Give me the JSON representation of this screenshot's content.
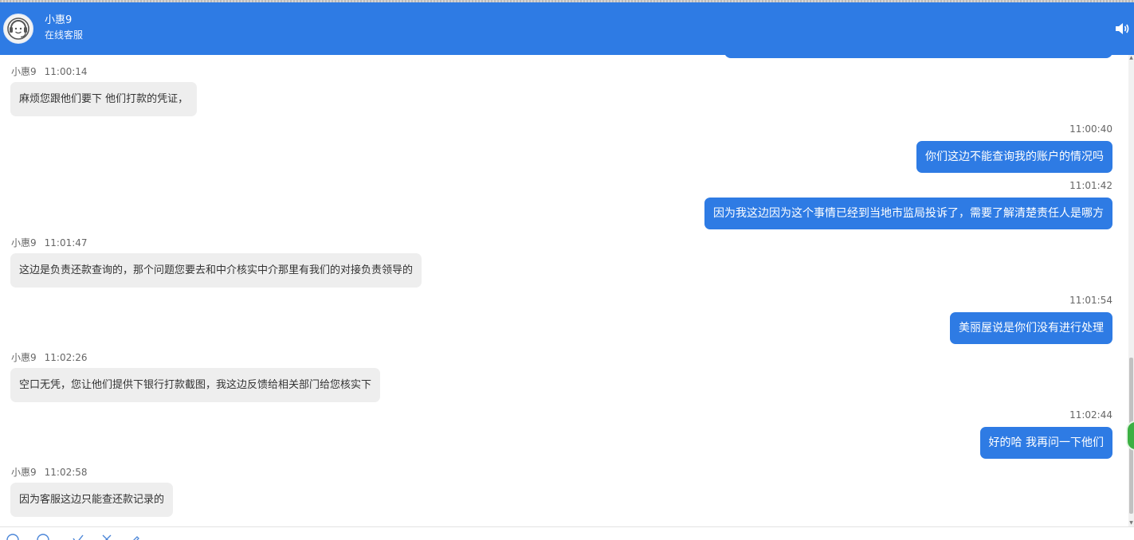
{
  "header": {
    "agent_name": "小惠9",
    "agent_status": "在线客服"
  },
  "messages": [
    {
      "side": "agent",
      "sender": "小惠9",
      "time": "11:00:14",
      "text": "麻烦您跟他们要下 他们打款的凭证，"
    },
    {
      "side": "user",
      "time": "11:00:40",
      "text": "你们这边不能查询我的账户的情况吗"
    },
    {
      "side": "user",
      "time": "11:01:42",
      "text": "因为我这边因为这个事情已经到当地市监局投诉了，需要了解清楚责任人是哪方"
    },
    {
      "side": "agent",
      "sender": "小惠9",
      "time": "11:01:47",
      "text": "这边是负责还款查询的，那个问题您要去和中介核实中介那里有我们的对接负责领导的"
    },
    {
      "side": "user",
      "time": "11:01:54",
      "text": "美丽屋说是你们没有进行处理"
    },
    {
      "side": "agent",
      "sender": "小惠9",
      "time": "11:02:26",
      "text": "空口无凭，您让他们提供下银行打款截图，我这边反馈给相关部门给您核实下"
    },
    {
      "side": "user",
      "time": "11:02:44",
      "text": "好的哈 我再问一下他们"
    },
    {
      "side": "agent",
      "sender": "小惠9",
      "time": "11:02:58",
      "text": "因为客服这边只能查还款记录的"
    }
  ],
  "icons": {
    "avatar": "agent-avatar-icon",
    "sound": "speaker-icon",
    "toolbar": [
      "emoji-icon",
      "happy-face-icon",
      "check-icon",
      "scissors-icon",
      "pen-icon"
    ]
  },
  "colors": {
    "brand": "#2e7be4",
    "agent_bubble": "#eeeeee",
    "user_bubble": "#2e7be4"
  }
}
